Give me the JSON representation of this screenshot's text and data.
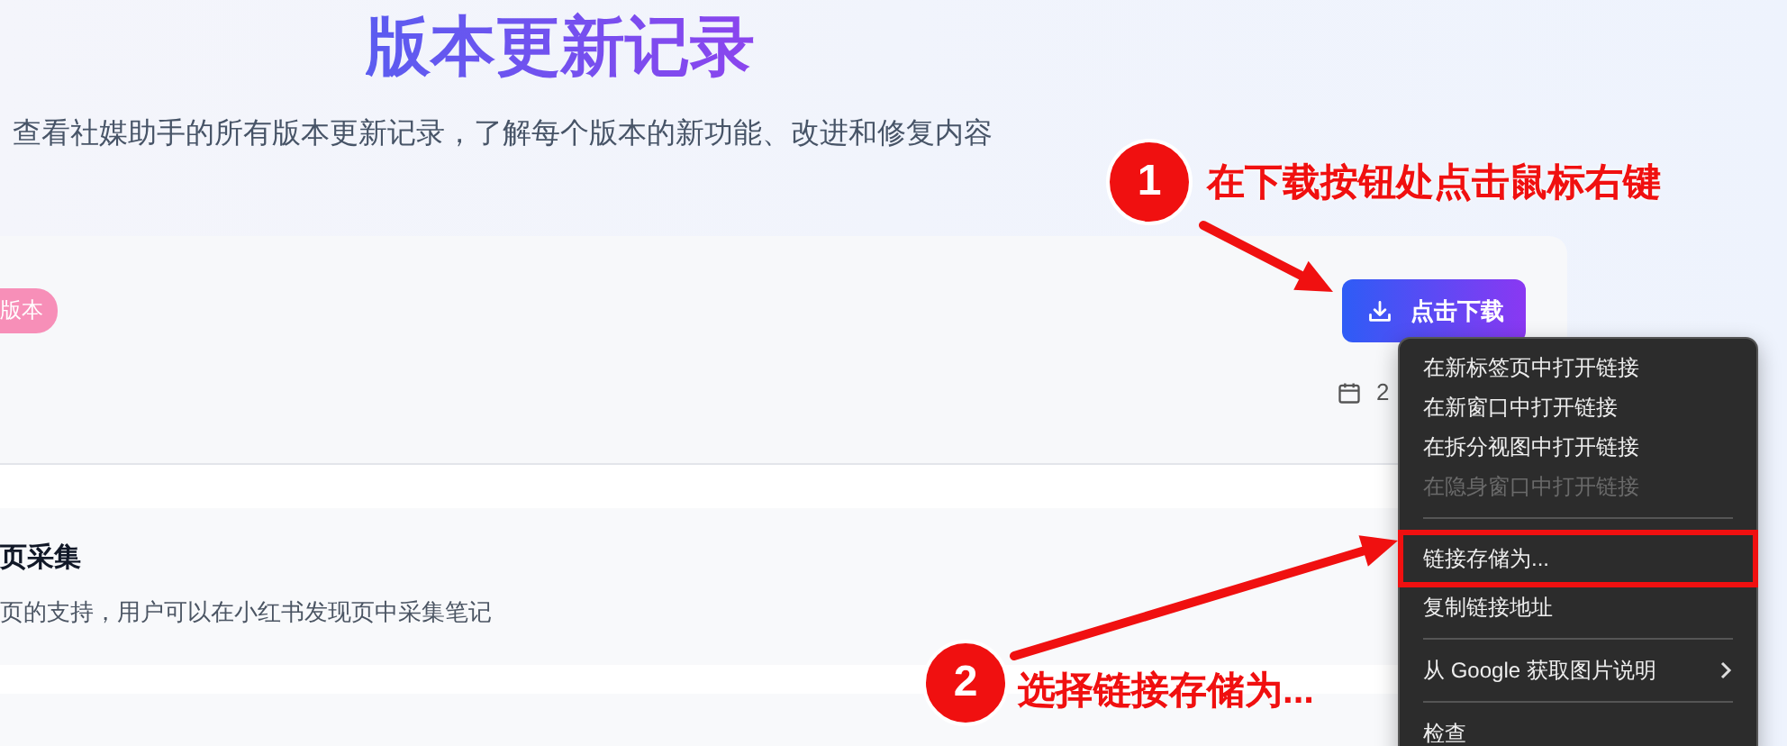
{
  "page": {
    "title": "版本更新记录",
    "subtitle": "查看社媒助手的所有版本更新记录，了解每个版本的新功能、改进和修复内容"
  },
  "release_card": {
    "badge": "版本",
    "download_button": "点击下载",
    "date": "2"
  },
  "changes": [
    {
      "title": "页采集",
      "description": "页的支持，用户可以在小红书发现页中采集笔记"
    }
  ],
  "context_menu": {
    "groups": [
      [
        {
          "label": "在新标签页中打开链接",
          "disabled": false,
          "submenu": false,
          "annotated": false
        },
        {
          "label": "在新窗口中打开链接",
          "disabled": false,
          "submenu": false,
          "annotated": false
        },
        {
          "label": "在拆分视图中打开链接",
          "disabled": false,
          "submenu": false,
          "annotated": false
        },
        {
          "label": "在隐身窗口中打开链接",
          "disabled": true,
          "submenu": false,
          "annotated": false
        }
      ],
      [
        {
          "label": "链接存储为...",
          "disabled": false,
          "submenu": false,
          "annotated": true
        },
        {
          "label": "复制链接地址",
          "disabled": false,
          "submenu": false,
          "annotated": false
        }
      ],
      [
        {
          "label": "从 Google 获取图片说明",
          "disabled": false,
          "submenu": true,
          "annotated": false
        }
      ],
      [
        {
          "label": "检查",
          "disabled": false,
          "submenu": false,
          "annotated": false
        }
      ]
    ]
  },
  "annotations": [
    {
      "number": "1",
      "text": "在下载按钮处点击鼠标右键"
    },
    {
      "number": "2",
      "text": "选择链接存储为..."
    }
  ]
}
